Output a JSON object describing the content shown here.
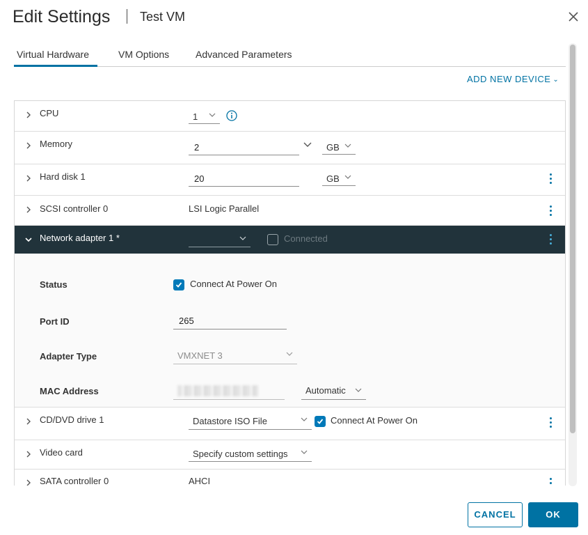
{
  "header": {
    "title": "Edit Settings",
    "subtitle": "Test VM"
  },
  "tabs": [
    {
      "label": "Virtual Hardware",
      "active": true
    },
    {
      "label": "VM Options",
      "active": false
    },
    {
      "label": "Advanced Parameters",
      "active": false
    }
  ],
  "add_device": {
    "label": "ADD NEW DEVICE"
  },
  "devices": {
    "cpu": {
      "label": "CPU",
      "value": "1"
    },
    "memory": {
      "label": "Memory",
      "value": "2",
      "unit": "GB"
    },
    "hard_disk": {
      "label": "Hard disk 1",
      "value": "20",
      "unit": "GB"
    },
    "scsi": {
      "label": "SCSI controller 0",
      "value": "LSI Logic Parallel"
    },
    "network": {
      "label": "Network adapter 1 *",
      "network_value": "",
      "connected_label": "Connected",
      "connected_checked": false,
      "status_label": "Status",
      "status_checkbox_label": "Connect At Power On",
      "status_checked": true,
      "port_id_label": "Port ID",
      "port_id_value": "265",
      "adapter_type_label": "Adapter Type",
      "adapter_type_value": "VMXNET 3",
      "mac_label": "MAC Address",
      "mac_mode": "Automatic"
    },
    "cd_dvd": {
      "label": "CD/DVD drive 1",
      "value": "Datastore ISO File",
      "checkbox_label": "Connect At Power On",
      "checked": true
    },
    "video": {
      "label": "Video card",
      "value": "Specify custom settings"
    },
    "sata": {
      "label": "SATA controller 0",
      "value": "AHCI"
    }
  },
  "footer": {
    "cancel_label": "CANCEL",
    "ok_label": "OK"
  },
  "colors": {
    "accent": "#0072a3",
    "expanded_row_bg": "#21333b",
    "checkbox_checked": "#0079b8"
  }
}
